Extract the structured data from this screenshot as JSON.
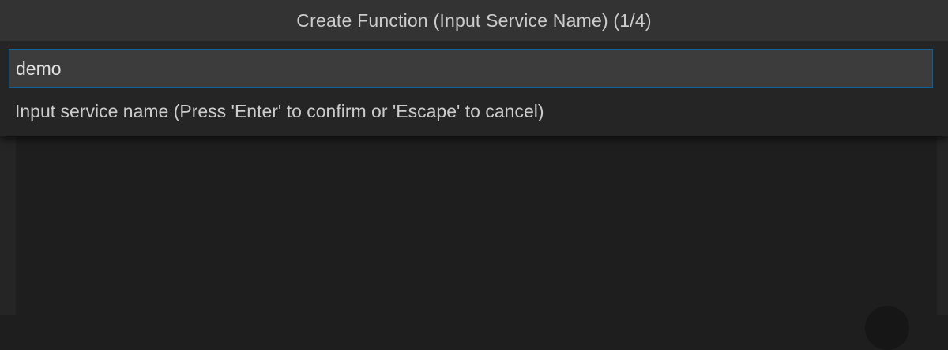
{
  "quick_input": {
    "title": "Create Function (Input Service Name) (1/4)",
    "input_value": "demo",
    "message": "Input service name (Press 'Enter' to confirm or 'Escape' to cancel)"
  },
  "colors": {
    "editor_background": "#1e1e1e",
    "panel_background": "#252526",
    "title_background": "#333334",
    "input_background": "#3c3c3c",
    "focus_border": "#0e639c",
    "text": "#cccccc"
  }
}
